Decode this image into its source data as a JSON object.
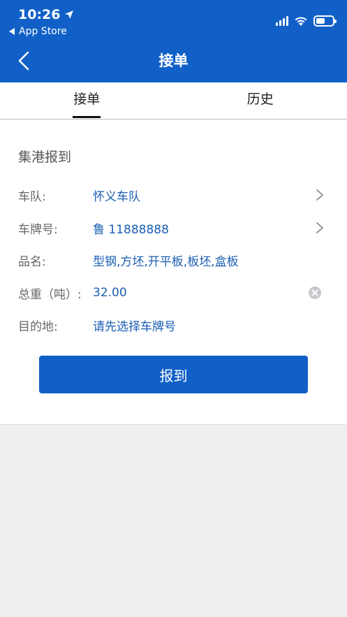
{
  "status_bar": {
    "time": "10:26",
    "back_app": "App Store"
  },
  "nav": {
    "title": "接单"
  },
  "tabs": [
    {
      "label": "接单",
      "active": true
    },
    {
      "label": "历史",
      "active": false
    }
  ],
  "form": {
    "section_title": "集港报到",
    "rows": [
      {
        "label": "车队:",
        "value": "怀义车队"
      },
      {
        "label": "车牌号:",
        "value": "鲁 11888888"
      },
      {
        "label": "品名:",
        "value": "型钢,方坯,开平板,板坯,盒板"
      },
      {
        "label": "总重（吨）:",
        "value": "32.00"
      },
      {
        "label": "目的地:",
        "value": "请先选择车牌号"
      }
    ],
    "submit_label": "报到"
  },
  "colors": {
    "brand_blue": "#1160c8",
    "value_blue": "#1a5fb4",
    "background": "#efeff1"
  }
}
